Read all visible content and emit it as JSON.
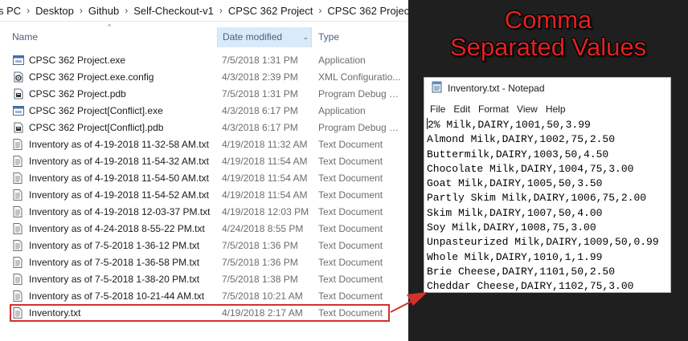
{
  "breadcrumb": [
    "s PC",
    "Desktop",
    "Github",
    "Self-Checkout-v1",
    "CPSC 362 Project",
    "CPSC 362 Project"
  ],
  "columns": {
    "name": "Name",
    "date_modified": "Date modified",
    "type": "Type"
  },
  "files": [
    {
      "icon": "exe-icon",
      "name": "CPSC 362 Project.exe",
      "date": "7/5/2018 1:31 PM",
      "type": "Application"
    },
    {
      "icon": "config-icon",
      "name": "CPSC 362 Project.exe.config",
      "date": "4/3/2018 2:39 PM",
      "type": "XML Configuratio..."
    },
    {
      "icon": "pdb-icon",
      "name": "CPSC 362 Project.pdb",
      "date": "7/5/2018 1:31 PM",
      "type": "Program Debug D..."
    },
    {
      "icon": "exe-icon",
      "name": "CPSC 362 Project[Conflict].exe",
      "date": "4/3/2018 6:17 PM",
      "type": "Application"
    },
    {
      "icon": "pdb-icon",
      "name": "CPSC 362 Project[Conflict].pdb",
      "date": "4/3/2018 6:17 PM",
      "type": "Program Debug D..."
    },
    {
      "icon": "text-file-icon",
      "name": "Inventory as of 4-19-2018 11-32-58 AM.txt",
      "date": "4/19/2018 11:32 AM",
      "type": "Text Document"
    },
    {
      "icon": "text-file-icon",
      "name": "Inventory as of 4-19-2018 11-54-32 AM.txt",
      "date": "4/19/2018 11:54 AM",
      "type": "Text Document"
    },
    {
      "icon": "text-file-icon",
      "name": "Inventory as of 4-19-2018 11-54-50 AM.txt",
      "date": "4/19/2018 11:54 AM",
      "type": "Text Document"
    },
    {
      "icon": "text-file-icon",
      "name": "Inventory as of 4-19-2018 11-54-52 AM.txt",
      "date": "4/19/2018 11:54 AM",
      "type": "Text Document"
    },
    {
      "icon": "text-file-icon",
      "name": "Inventory as of 4-19-2018 12-03-37 PM.txt",
      "date": "4/19/2018 12:03 PM",
      "type": "Text Document"
    },
    {
      "icon": "text-file-icon",
      "name": "Inventory as of 4-24-2018 8-55-22 PM.txt",
      "date": "4/24/2018 8:55 PM",
      "type": "Text Document"
    },
    {
      "icon": "text-file-icon",
      "name": "Inventory as of 7-5-2018 1-36-12 PM.txt",
      "date": "7/5/2018 1:36 PM",
      "type": "Text Document"
    },
    {
      "icon": "text-file-icon",
      "name": "Inventory as of 7-5-2018 1-36-58 PM.txt",
      "date": "7/5/2018 1:36 PM",
      "type": "Text Document"
    },
    {
      "icon": "text-file-icon",
      "name": "Inventory as of 7-5-2018 1-38-20 PM.txt",
      "date": "7/5/2018 1:38 PM",
      "type": "Text Document"
    },
    {
      "icon": "text-file-icon",
      "name": "Inventory as of 7-5-2018 10-21-44 AM.txt",
      "date": "7/5/2018 10:21 AM",
      "type": "Text Document"
    },
    {
      "icon": "text-file-icon",
      "name": "Inventory.txt",
      "date": "4/19/2018 2:17 AM",
      "type": "Text Document",
      "highlighted": true
    }
  ],
  "headline": [
    "Comma",
    "Separated Values"
  ],
  "notepad": {
    "title": "Inventory.txt - Notepad",
    "menu": [
      "File",
      "Edit",
      "Format",
      "View",
      "Help"
    ],
    "lines": [
      "2% Milk,DAIRY,1001,50,3.99",
      "Almond Milk,DAIRY,1002,75,2.50",
      "Buttermilk,DAIRY,1003,50,4.50",
      "Chocolate Milk,DAIRY,1004,75,3.00",
      "Goat Milk,DAIRY,1005,50,3.50",
      "Partly Skim Milk,DAIRY,1006,75,2.00",
      "Skim Milk,DAIRY,1007,50,4.00",
      "Soy Milk,DAIRY,1008,75,3.00",
      "Unpasteurized Milk,DAIRY,1009,50,0.99",
      "Whole Milk,DAIRY,1010,1,1.99",
      "Brie Cheese,DAIRY,1101,50,2.50",
      "Cheddar Cheese,DAIRY,1102,75,3.00"
    ]
  },
  "colors": {
    "highlight": "#d2312e",
    "headline": "#e02222",
    "selected_column": "#d9ebf9",
    "dark_background": "#1f1f1f"
  }
}
